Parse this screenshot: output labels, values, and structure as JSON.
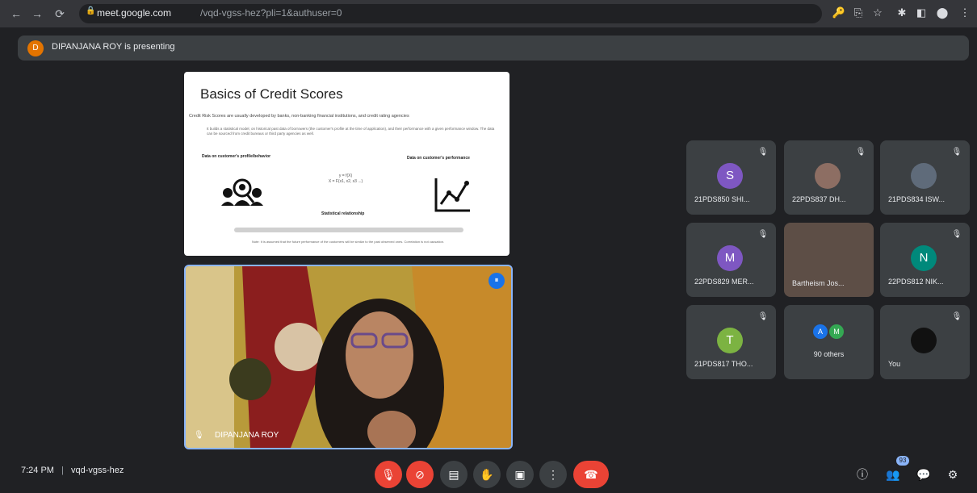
{
  "browser": {
    "url_host": "meet.google.com",
    "url_path": "/vqd-vgss-hez?pli=1&authuser=0",
    "nav": {
      "back": "←",
      "forward": "→",
      "reload": "⟳"
    },
    "extensions": [
      "🔑",
      "⎘",
      "☆",
      "✱",
      "◧",
      "⬤",
      "⋮"
    ]
  },
  "banner": {
    "avatar_initial": "D",
    "text": "DIPANJANA ROY is presenting"
  },
  "slide": {
    "title": "Basics of Credit Scores",
    "line": "Credit Risk Scores are usually developed by banks, non-banking financial institutions, and credit rating agencies",
    "paragraph": "It builds a statistical model, on historical past data of borrowers (the customer's profile at the time of application), and their performance with a given performance window. The data can be sourced from credit bureaus or third party agencies as well.",
    "left_heading": "Data on customer's profile/behavior",
    "right_heading": "Data on customer's performance",
    "formula": "y = f(X)\nX = F(x1, x2, x3 ...)",
    "model": "Statistical relationship",
    "footer": "Note: It is assumed that the future performance of the customers will be similar to the past observed ones. Correlation is not causation."
  },
  "presenter": {
    "name": "DIPANJANA ROY",
    "audio_icon": "audio-level-icon"
  },
  "tiles": [
    {
      "name": "21PDS850 SHI...",
      "initial": "S",
      "color": "#7e57c2",
      "type": "initial"
    },
    {
      "name": "22PDS837 DH...",
      "type": "photo",
      "color": "#8d6e63"
    },
    {
      "name": "21PDS834 ISW...",
      "type": "photo",
      "color": "#5f6b7a"
    },
    {
      "name": "22PDS829 MER...",
      "initial": "M",
      "color": "#7e57c2",
      "type": "initial"
    },
    {
      "name": "Bartheism Jos...",
      "type": "video",
      "color": "#5d4e46"
    },
    {
      "name": "22PDS812 NIK...",
      "initial": "N",
      "color": "#00897b",
      "type": "initial"
    },
    {
      "name": "21PDS817 THO...",
      "initial": "T",
      "color": "#7cb342",
      "type": "initial"
    },
    {
      "name": "90 others",
      "type": "others",
      "initials": [
        "A",
        "M"
      ]
    },
    {
      "name": "You",
      "type": "photo",
      "color": "#111111"
    }
  ],
  "meeting": {
    "time": "7:24 PM",
    "separator": "|",
    "code": "vqd-vgss-hez"
  },
  "controls": [
    {
      "name": "mic-off-button",
      "icon": "🎙",
      "red": true
    },
    {
      "name": "camera-off-button",
      "icon": "⊘",
      "red": true
    },
    {
      "name": "captions-button",
      "icon": "▤",
      "red": false
    },
    {
      "name": "raise-hand-button",
      "icon": "✋",
      "red": false
    },
    {
      "name": "present-button",
      "icon": "▣",
      "red": false
    },
    {
      "name": "more-options-button",
      "icon": "⋮",
      "red": false
    }
  ],
  "end_call_icon": "☎",
  "right_controls": {
    "info": "ⓘ",
    "people": "👥",
    "chat": "💬",
    "activities": "⚙",
    "people_badge": "93"
  }
}
